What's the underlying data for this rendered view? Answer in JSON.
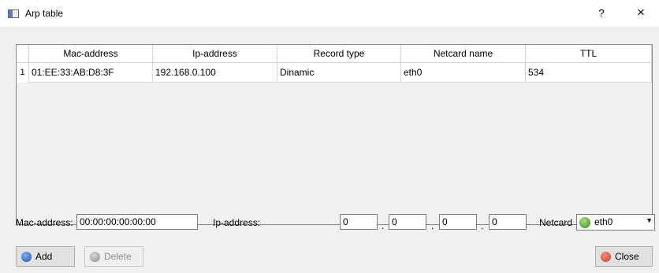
{
  "window": {
    "title": "Arp table",
    "help_label": "?",
    "close_glyph": "×"
  },
  "table": {
    "columns": [
      "Mac-address",
      "Ip-address",
      "Record type",
      "Netcard name",
      "TTL"
    ],
    "rows": [
      {
        "num": "1",
        "mac": "01:EE:33:AB:D8:3F",
        "ip": "192.168.0.100",
        "type": "Dinamic",
        "netcard": "eth0",
        "ttl": "534"
      }
    ]
  },
  "form": {
    "mac_label": "Mac-address:",
    "mac_value": "00:00:00:00:00:00",
    "ip_label": "Ip-address:",
    "ip_octets": [
      "0",
      "0",
      "0",
      "0"
    ],
    "ip_sep": ".",
    "netcard_label": "Netcard",
    "netcard_value": "eth0"
  },
  "buttons": {
    "add": "Add",
    "delete": "Delete",
    "close": "Close"
  },
  "icons": {
    "title": "window-icon",
    "add": "plus-circle-icon",
    "delete": "minus-circle-icon",
    "close": "cancel-circle-icon",
    "netcard": "network-ok-icon"
  }
}
